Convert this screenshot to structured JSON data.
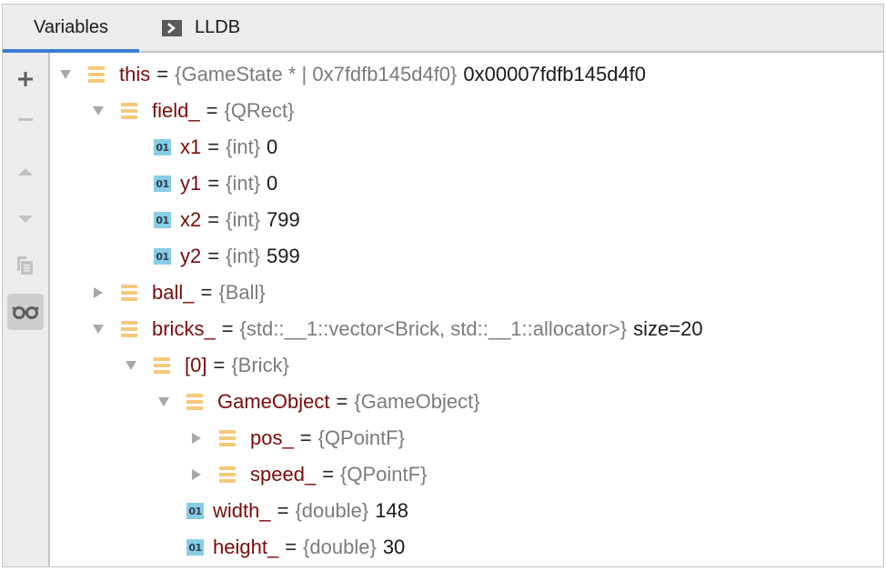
{
  "tabs": {
    "variables": "Variables",
    "lldb": "LLDB",
    "active": "variables"
  },
  "toolbar": {
    "buttons": [
      {
        "icon": "plus-icon",
        "label": "New Watch",
        "enabled": true
      },
      {
        "icon": "minus-icon",
        "label": "Remove Watch",
        "enabled": false
      },
      {
        "icon": "arrow-up-icon",
        "label": "Move Up",
        "enabled": false
      },
      {
        "icon": "arrow-down-icon",
        "label": "Move Down",
        "enabled": false
      },
      {
        "icon": "duplicate-icon",
        "label": "Duplicate",
        "enabled": false
      },
      {
        "icon": "glasses-icon",
        "label": "Show Watches",
        "enabled": true,
        "active": true
      }
    ]
  },
  "colors": {
    "accent": "#3d7dd0",
    "name": "#7a0b0b",
    "type": "#7b7b7b",
    "struct_icon": "#f5c97a",
    "primitive_icon": "#87cde6"
  },
  "tree": {
    "primitive_badge": "01",
    "rows": [
      {
        "depth": 0,
        "state": "expanded",
        "kind": "struct",
        "name": "this",
        "type": "{GameState * | 0x7fdfb145d4f0}",
        "value": "0x00007fdfb145d4f0"
      },
      {
        "depth": 1,
        "state": "expanded",
        "kind": "struct",
        "name": "field_",
        "type": "{QRect}",
        "value": ""
      },
      {
        "depth": 2,
        "state": "leaf",
        "kind": "primitive",
        "name": "x1",
        "type": "{int}",
        "value": "0"
      },
      {
        "depth": 2,
        "state": "leaf",
        "kind": "primitive",
        "name": "y1",
        "type": "{int}",
        "value": "0"
      },
      {
        "depth": 2,
        "state": "leaf",
        "kind": "primitive",
        "name": "x2",
        "type": "{int}",
        "value": "799"
      },
      {
        "depth": 2,
        "state": "leaf",
        "kind": "primitive",
        "name": "y2",
        "type": "{int}",
        "value": "599"
      },
      {
        "depth": 1,
        "state": "collapsed",
        "kind": "struct",
        "name": "ball_",
        "type": "{Ball}",
        "value": ""
      },
      {
        "depth": 1,
        "state": "expanded",
        "kind": "struct",
        "name": "bricks_",
        "type": "{std::__1::vector<Brick, std::__1::allocator>}",
        "value": "size=20"
      },
      {
        "depth": 2,
        "state": "expanded",
        "kind": "struct",
        "name": "[0]",
        "type": "{Brick}",
        "value": ""
      },
      {
        "depth": 3,
        "state": "expanded",
        "kind": "struct",
        "name": "GameObject",
        "type": "{GameObject}",
        "value": ""
      },
      {
        "depth": 4,
        "state": "collapsed",
        "kind": "struct",
        "name": "pos_",
        "type": "{QPointF}",
        "value": ""
      },
      {
        "depth": 4,
        "state": "collapsed",
        "kind": "struct",
        "name": "speed_",
        "type": "{QPointF}",
        "value": ""
      },
      {
        "depth": 3,
        "state": "leaf",
        "kind": "primitive",
        "name": "width_",
        "type": "{double}",
        "value": "148"
      },
      {
        "depth": 3,
        "state": "leaf",
        "kind": "primitive",
        "name": "height_",
        "type": "{double}",
        "value": "30"
      }
    ]
  }
}
